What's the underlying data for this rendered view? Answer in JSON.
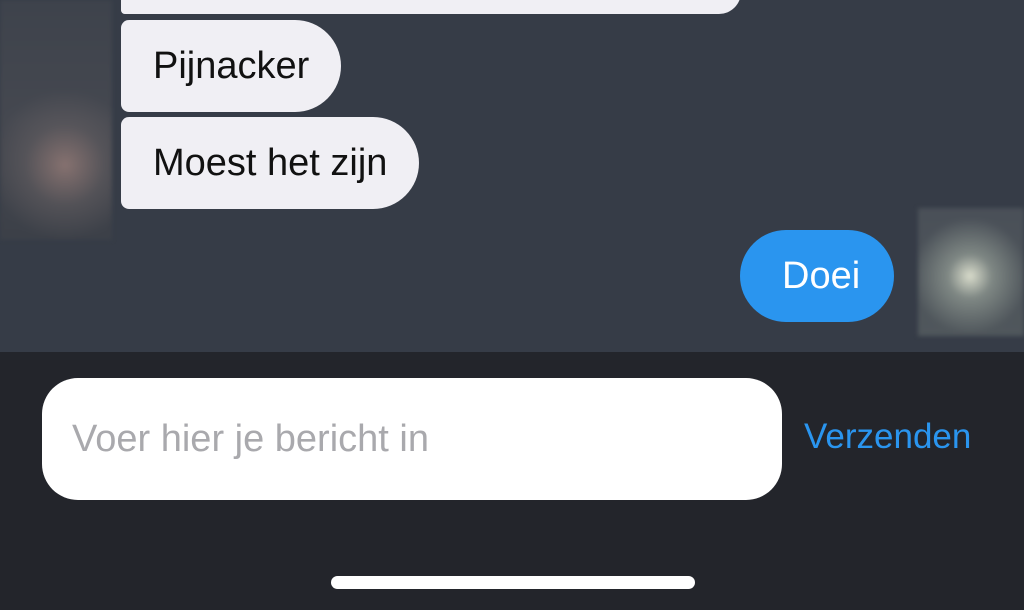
{
  "conversation": {
    "messages": [
      {
        "direction": "received",
        "text": ""
      },
      {
        "direction": "received",
        "text": "Pijnacker"
      },
      {
        "direction": "received",
        "text": "Moest het zijn"
      },
      {
        "direction": "sent",
        "text": "Doei"
      }
    ]
  },
  "composer": {
    "placeholder": "Voer hier je bericht in",
    "value": "",
    "send_label": "Verzenden"
  },
  "colors": {
    "chat_background": "#363c47",
    "input_bar_background": "#23252b",
    "received_bubble": "#f0eff4",
    "sent_bubble": "#2a95ef",
    "accent": "#2a95ef"
  }
}
